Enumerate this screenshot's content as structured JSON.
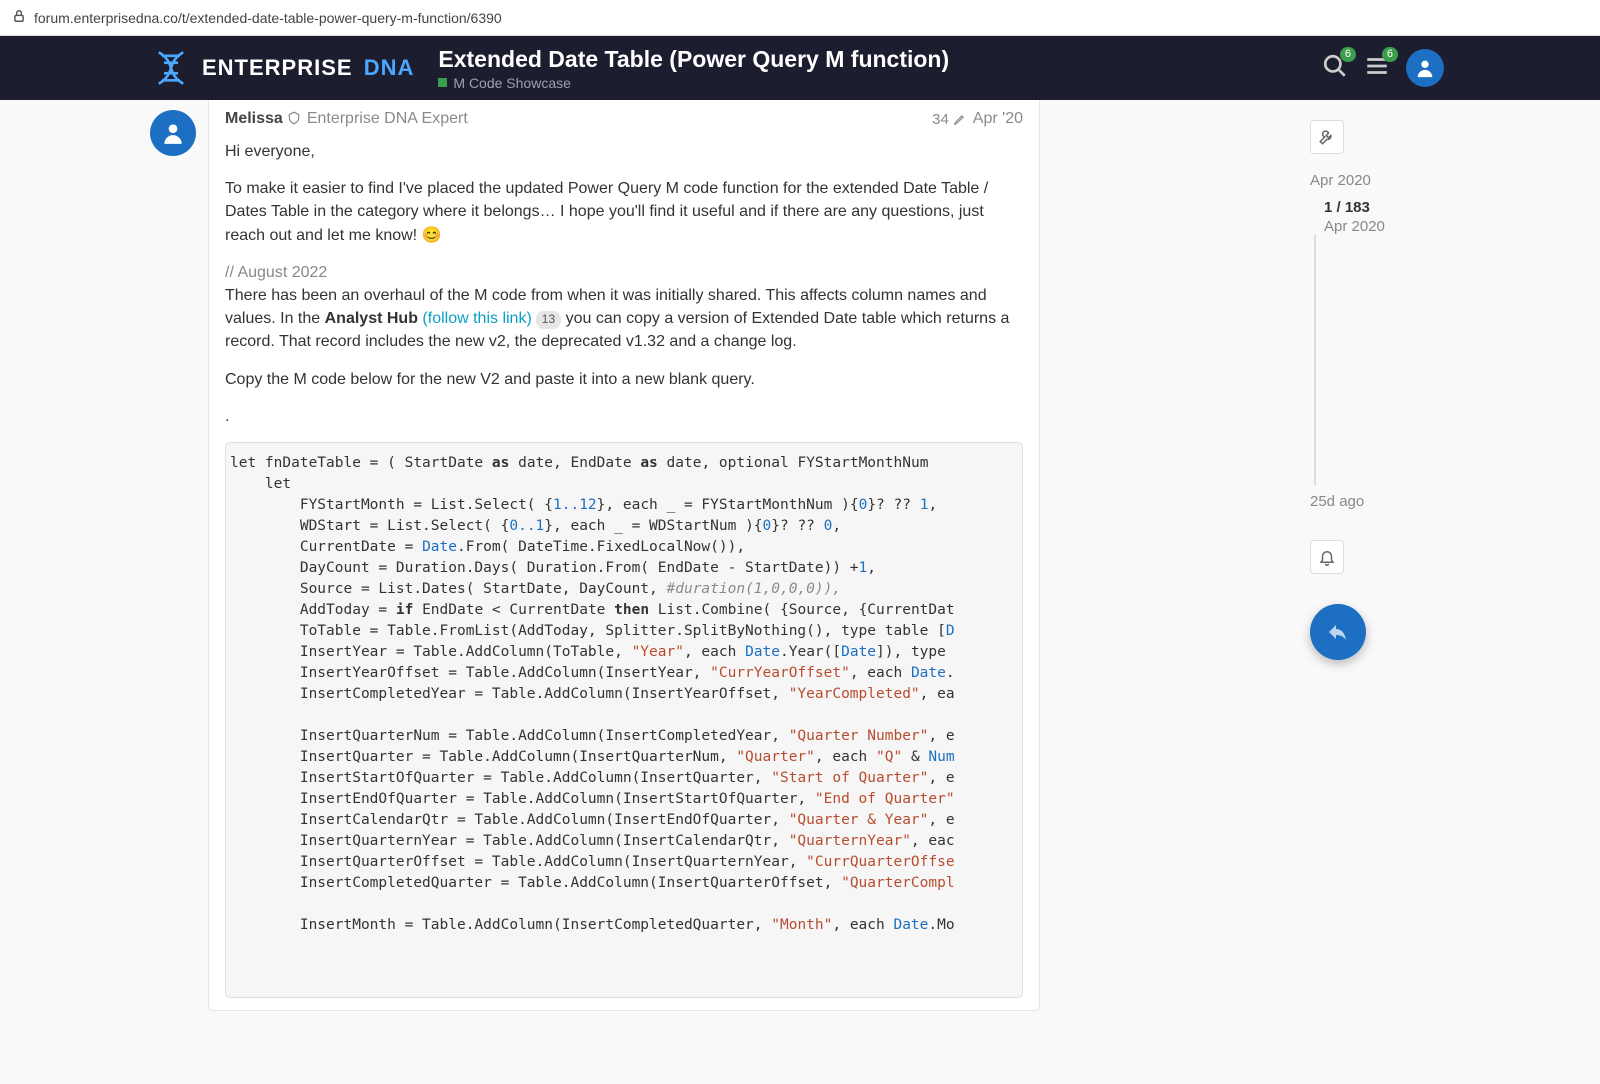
{
  "browser": {
    "url": "forum.enterprisedna.co/t/extended-date-table-power-query-m-function/6390"
  },
  "header": {
    "logo_text_a": "ENTERPRISE",
    "logo_text_b": "DNA",
    "topic_title": "Extended Date Table (Power Query M function)",
    "category": "M Code Showcase",
    "search_badge": "6",
    "menu_badge": "6"
  },
  "post": {
    "author": "Melissa",
    "role": "Enterprise DNA Expert",
    "edit_count": "34",
    "date": "Apr '20",
    "p1": "Hi everyone,",
    "p2": "To make it easier to find I've placed the updated Power Query M code function for the extended Date Table / Dates Table in the category where it belongs… I hope you'll find it useful and if there are any questions, just reach out and let me know! 😊",
    "comment_date": "// August 2022",
    "p3a": "There has been an overhaul of the M code from when it was initially shared. This affects column names and values. In the ",
    "analyst_hub": "Analyst Hub",
    "follow_link": "(follow this link)",
    "link_badge": "13",
    "p3b": " you can copy a version of Extended Date table which returns a record. That record includes the new v2, the deprecated v1.32 and a change log.",
    "p4": "Copy the M code below for the new V2 and paste it into a new blank query.",
    "dot": "."
  },
  "code": {
    "l01a": "let fnDateTable = ( StartDate ",
    "l01b": "as",
    "l01c": " date, EndDate ",
    "l01d": "as",
    "l01e": " date, optional FYStartMonthNum",
    "l02": "    let",
    "l03a": "        FYStartMonth = List.Select( {",
    "l03b": "1..12",
    "l03c": "}, each _ = FYStartMonthNum ){",
    "l03d": "0",
    "l03e": "}? ?? ",
    "l03f": "1",
    "l03g": ",",
    "l04a": "        WDStart = List.Select( {",
    "l04b": "0..1",
    "l04c": "}, each _ = WDStartNum ){",
    "l04d": "0",
    "l04e": "}? ?? ",
    "l04f": "0",
    "l04g": ",",
    "l05a": "        CurrentDate = ",
    "l05b": "Date",
    "l05c": ".From( DateTime.FixedLocalNow()),",
    "l06a": "        DayCount = Duration.Days( Duration.From( EndDate - StartDate)) +",
    "l06b": "1",
    "l06c": ",",
    "l07a": "        Source = List.Dates( StartDate, DayCount, ",
    "l07b": "#duration(1,0,0,0)),",
    "l08a": "        AddToday = ",
    "l08b": "if",
    "l08c": " EndDate < CurrentDate ",
    "l08d": "then",
    "l08e": " List.Combine( {Source, {CurrentDat",
    "l09a": "        ToTable = Table.FromList(AddToday, Splitter.SplitByNothing(), type table [",
    "l09b": "D",
    "l10a": "        InsertYear = Table.AddColumn(ToTable, ",
    "l10b": "\"Year\"",
    "l10c": ", each ",
    "l10d": "Date",
    "l10e": ".Year([",
    "l10f": "Date",
    "l10g": "]), type ",
    "l11a": "        InsertYearOffset = Table.AddColumn(InsertYear, ",
    "l11b": "\"CurrYearOffset\"",
    "l11c": ", each ",
    "l11d": "Date",
    "l11e": ".",
    "l12a": "        InsertCompletedYear = Table.AddColumn(InsertYearOffset, ",
    "l12b": "\"YearCompleted\"",
    "l12c": ", ea",
    "l13": "",
    "l14a": "        InsertQuarterNum = Table.AddColumn(InsertCompletedYear, ",
    "l14b": "\"Quarter Number\"",
    "l14c": ", e",
    "l15a": "        InsertQuarter = Table.AddColumn(InsertQuarterNum, ",
    "l15b": "\"Quarter\"",
    "l15c": ", each ",
    "l15d": "\"Q\"",
    "l15e": " & ",
    "l15f": "Num",
    "l16a": "        InsertStartOfQuarter = Table.AddColumn(InsertQuarter, ",
    "l16b": "\"Start of Quarter\"",
    "l16c": ", e",
    "l17a": "        InsertEndOfQuarter = Table.AddColumn(InsertStartOfQuarter, ",
    "l17b": "\"End of Quarter\"",
    "l18a": "        InsertCalendarQtr = Table.AddColumn(InsertEndOfQuarter, ",
    "l18b": "\"Quarter & Year\"",
    "l18c": ", e",
    "l19a": "        InsertQuarternYear = Table.AddColumn(InsertCalendarQtr, ",
    "l19b": "\"QuarternYear\"",
    "l19c": ", eac",
    "l20a": "        InsertQuarterOffset = Table.AddColumn(InsertQuarternYear, ",
    "l20b": "\"CurrQuarterOffse",
    "l21a": "        InsertCompletedQuarter = Table.AddColumn(InsertQuarterOffset, ",
    "l21b": "\"QuarterCompl",
    "l22": "",
    "l23a": "        InsertMonth = Table.AddColumn(InsertCompletedQuarter, ",
    "l23b": "\"Month\"",
    "l23c": ", each ",
    "l23d": "Date",
    "l23e": ".Mo"
  },
  "timeline": {
    "top": "Apr 2020",
    "pos": "1 / 183",
    "pos_date": "Apr 2020",
    "bottom": "25d ago"
  }
}
